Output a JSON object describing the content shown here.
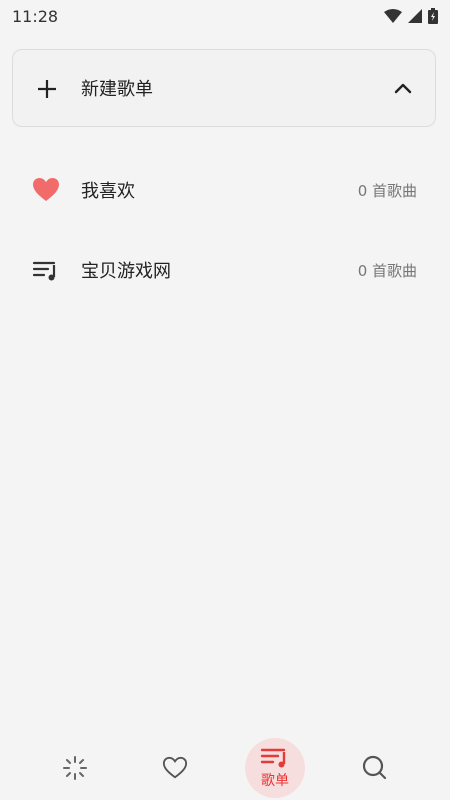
{
  "status_bar": {
    "time": "11:28"
  },
  "new_playlist": {
    "label": "新建歌单"
  },
  "playlists": [
    {
      "name": "我喜欢",
      "count": "0 首歌曲",
      "icon": "heart-icon"
    },
    {
      "name": "宝贝游戏网",
      "count": "0 首歌曲",
      "icon": "music-list-icon"
    }
  ],
  "bottom_nav": {
    "items": [
      {
        "id": "discover",
        "icon": "sparkle-icon",
        "label": ""
      },
      {
        "id": "favorite",
        "icon": "heart-outline-icon",
        "label": ""
      },
      {
        "id": "playlist",
        "icon": "music-list-icon",
        "label": "歌单",
        "active": true
      },
      {
        "id": "search",
        "icon": "search-icon",
        "label": ""
      }
    ]
  },
  "colors": {
    "background": "#f4f4f4",
    "accent": "#e33a3a",
    "heart": "#f26b6b",
    "active_bg": "#f6dede"
  }
}
